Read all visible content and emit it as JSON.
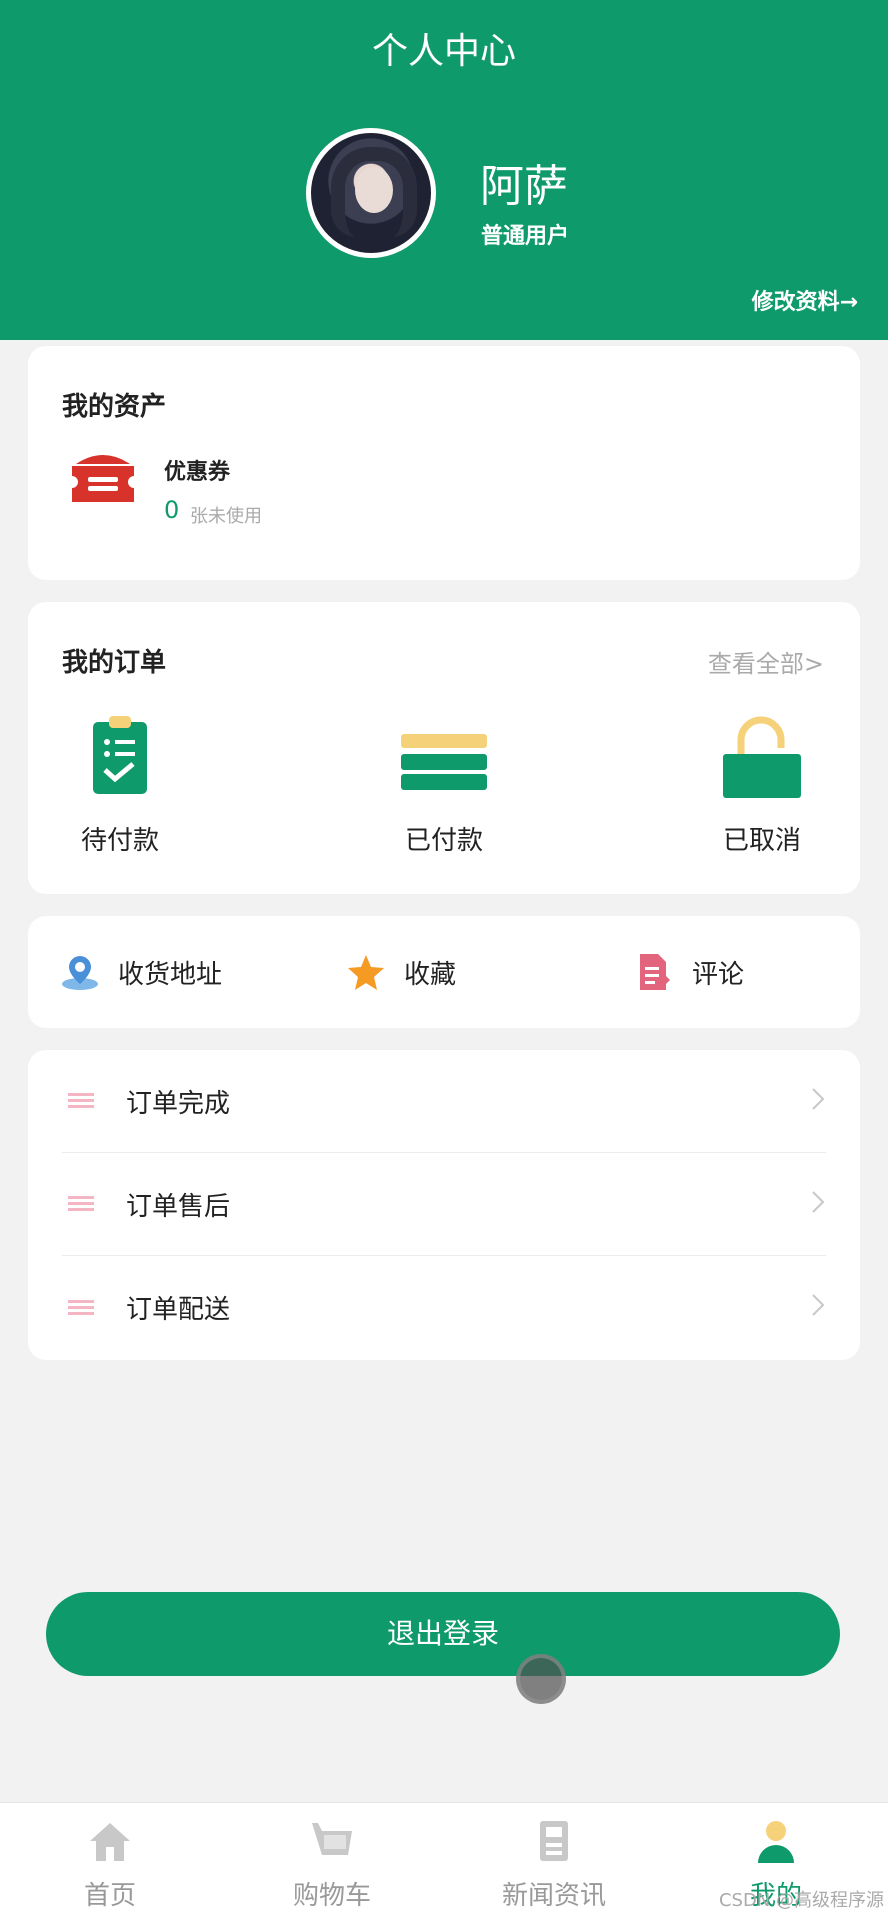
{
  "header": {
    "title": "个人中心",
    "username": "阿萨",
    "user_type": "普通用户",
    "edit_link": "修改资料→"
  },
  "assets": {
    "title": "我的资产",
    "coupon": {
      "name": "优惠券",
      "count": "0",
      "unit": "张未使用",
      "icon": "coupon-icon"
    }
  },
  "orders": {
    "title": "我的订单",
    "view_all": "查看全部>",
    "items": [
      {
        "label": "待付款",
        "icon": "clipboard-check-icon"
      },
      {
        "label": "已付款",
        "icon": "stacked-cards-icon"
      },
      {
        "label": "已取消",
        "icon": "unlocked-padlock-icon"
      }
    ]
  },
  "shortcuts": [
    {
      "label": "收货地址",
      "icon": "location-pin-icon"
    },
    {
      "label": "收藏",
      "icon": "star-icon"
    },
    {
      "label": "评论",
      "icon": "document-edit-icon"
    }
  ],
  "menu": [
    {
      "label": "订单完成"
    },
    {
      "label": "订单售后"
    },
    {
      "label": "订单配送"
    }
  ],
  "logout_label": "退出登录",
  "tabbar": [
    {
      "label": "首页",
      "icon": "home-icon"
    },
    {
      "label": "购物车",
      "icon": "cart-icon"
    },
    {
      "label": "新闻资讯",
      "icon": "news-icon"
    },
    {
      "label": "我的",
      "icon": "user-icon",
      "active": true
    }
  ],
  "watermark": "CSDN @高级程序源",
  "colors": {
    "primary": "#0e9a6b",
    "accent_yellow": "#f5d27a",
    "coupon_red": "#d8332a"
  }
}
